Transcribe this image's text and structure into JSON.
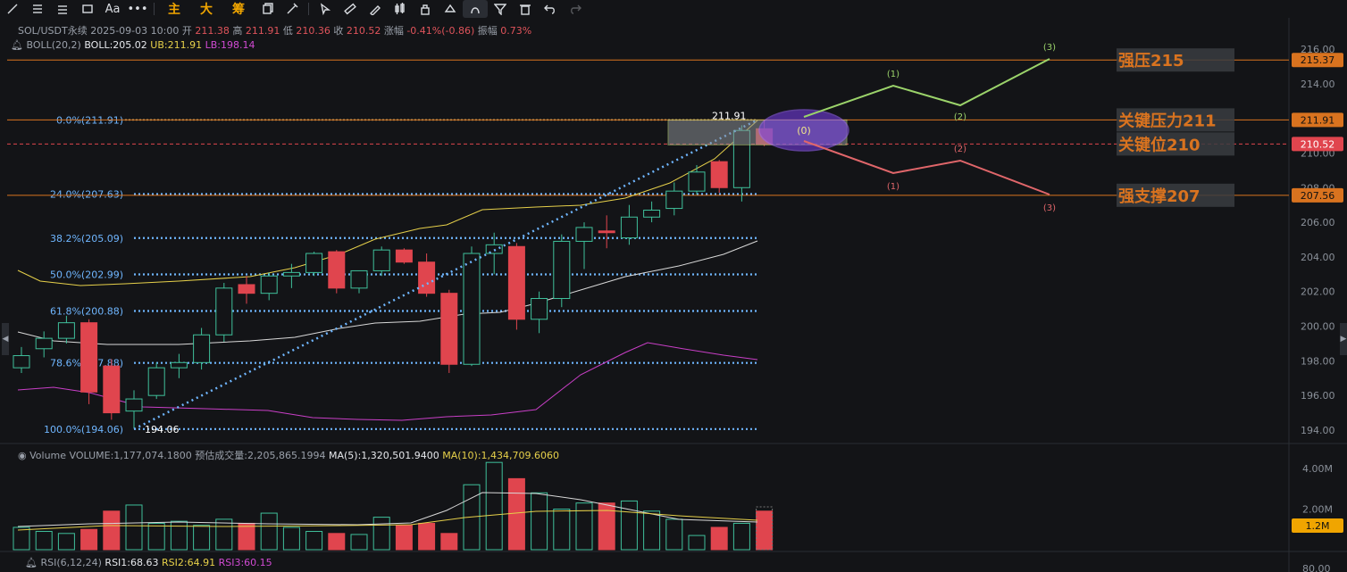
{
  "toolbar": {
    "tools": [
      "line",
      "menu",
      "menu2",
      "rect",
      "text",
      "more"
    ],
    "text_label": "Aa",
    "indicator_main": "主",
    "indicator_big": "大",
    "indicator_chip": "筹"
  },
  "info": {
    "symbol": "SOL/USDT永续",
    "datetime": "2025-09-03 10:00",
    "open_label": "开",
    "open": "211.38",
    "high_label": "高",
    "high": "211.91",
    "low_label": "低",
    "low": "210.36",
    "close_label": "收",
    "close": "210.52",
    "change_label": "涨幅",
    "change": "-0.41%(-0.86)",
    "amp_label": "振幅",
    "amp": "0.73%",
    "boll_name": "BOLL(20,2)",
    "boll_mid": "BOLL:205.02",
    "boll_ub": "UB:211.91",
    "boll_lb": "LB:198.14"
  },
  "volume": {
    "title": "Volume",
    "vol": "VOLUME:1,177,074.1800",
    "est": "预估成交量:2,205,865.1994",
    "ma5": "MA(5):1,320,501.9400",
    "ma10": "MA(10):1,434,709.6060",
    "current_tag": "1.2M",
    "axis": [
      "4.00M",
      "2.00M"
    ]
  },
  "rsi": {
    "name": "RSI(6,12,24)",
    "rsi1": "RSI1:68.63",
    "rsi2": "RSI2:64.91",
    "rsi3": "RSI3:60.15",
    "axis_top": "80.00"
  },
  "price_axis": [
    "216.00",
    "214.00",
    "212.00",
    "210.00",
    "208.00",
    "206.00",
    "204.00",
    "202.00",
    "200.00",
    "198.00",
    "196.00",
    "194.00"
  ],
  "fib": [
    {
      "label": "0.0%(211.91)",
      "price": 211.91
    },
    {
      "label": "24.0%(207.63)",
      "price": 207.63
    },
    {
      "label": "38.2%(205.09)",
      "price": 205.09
    },
    {
      "label": "50.0%(202.99)",
      "price": 202.99
    },
    {
      "label": "61.8%(200.88)",
      "price": 200.88
    },
    {
      "label": "78.6%(197.88)",
      "price": 197.88
    },
    {
      "label": "100.0%(194.06)",
      "price": 194.06
    }
  ],
  "levels": [
    {
      "label": "强压215",
      "price": 215.37,
      "tag": "215.37"
    },
    {
      "label": "关键压力211",
      "price": 211.91,
      "tag": "211.91"
    },
    {
      "label": "关键位210",
      "price": 210.52,
      "tag": "210.52"
    },
    {
      "label": "强支撑207",
      "price": 207.56,
      "tag": "207.56"
    }
  ],
  "annotations": {
    "high_mark": "211.91",
    "low_mark": "194.06",
    "wave0": "(0)",
    "up_waves": [
      "(1)",
      "(2)",
      "(3)"
    ],
    "down_waves": [
      "(1)",
      "(2)",
      "(3)"
    ]
  },
  "colors": {
    "up": "#3fc09b",
    "down": "#e0454e",
    "level": "#d9731f",
    "fib": "#6fb6ff",
    "boll_mid": "#d8d8d8",
    "boll_ub": "#e6d04a",
    "boll_lb": "#c93fc7",
    "wave_up": "#9bd36a",
    "wave_down": "#e0666a"
  },
  "chart_data": {
    "type": "candlestick",
    "candles": [
      {
        "o": 197.6,
        "h": 198.8,
        "l": 197.3,
        "c": 198.3
      },
      {
        "o": 198.7,
        "h": 199.7,
        "l": 198.2,
        "c": 199.3
      },
      {
        "o": 199.3,
        "h": 200.6,
        "l": 199.0,
        "c": 200.2
      },
      {
        "o": 200.2,
        "h": 200.4,
        "l": 195.5,
        "c": 196.2
      },
      {
        "o": 197.7,
        "h": 198.1,
        "l": 194.6,
        "c": 195.0
      },
      {
        "o": 195.1,
        "h": 196.3,
        "l": 194.1,
        "c": 195.8
      },
      {
        "o": 196.0,
        "h": 197.9,
        "l": 195.8,
        "c": 197.6
      },
      {
        "o": 197.6,
        "h": 198.4,
        "l": 197.0,
        "c": 197.9
      },
      {
        "o": 197.9,
        "h": 199.9,
        "l": 197.5,
        "c": 199.5
      },
      {
        "o": 199.5,
        "h": 202.5,
        "l": 199.1,
        "c": 202.2
      },
      {
        "o": 202.4,
        "h": 202.9,
        "l": 201.3,
        "c": 201.9
      },
      {
        "o": 201.9,
        "h": 203.1,
        "l": 201.5,
        "c": 202.9
      },
      {
        "o": 202.9,
        "h": 203.6,
        "l": 202.2,
        "c": 203.1
      },
      {
        "o": 203.1,
        "h": 204.3,
        "l": 202.9,
        "c": 204.2
      },
      {
        "o": 204.3,
        "h": 204.4,
        "l": 201.9,
        "c": 202.2
      },
      {
        "o": 202.2,
        "h": 203.2,
        "l": 201.9,
        "c": 203.2
      },
      {
        "o": 203.2,
        "h": 204.6,
        "l": 202.9,
        "c": 204.4
      },
      {
        "o": 204.4,
        "h": 204.5,
        "l": 203.6,
        "c": 203.7
      },
      {
        "o": 203.7,
        "h": 204.2,
        "l": 201.7,
        "c": 201.9
      },
      {
        "o": 201.9,
        "h": 202.1,
        "l": 197.3,
        "c": 197.8
      },
      {
        "o": 197.8,
        "h": 204.6,
        "l": 197.7,
        "c": 204.2
      },
      {
        "o": 204.2,
        "h": 205.4,
        "l": 203.0,
        "c": 204.7
      },
      {
        "o": 204.6,
        "h": 204.8,
        "l": 199.8,
        "c": 200.4
      },
      {
        "o": 200.4,
        "h": 202.0,
        "l": 199.6,
        "c": 201.6
      },
      {
        "o": 201.6,
        "h": 205.3,
        "l": 201.1,
        "c": 204.9
      },
      {
        "o": 204.9,
        "h": 206.0,
        "l": 203.3,
        "c": 205.7
      },
      {
        "o": 205.5,
        "h": 206.4,
        "l": 204.5,
        "c": 205.4
      },
      {
        "o": 205.1,
        "h": 207.0,
        "l": 204.7,
        "c": 206.3
      },
      {
        "o": 206.3,
        "h": 207.2,
        "l": 206.0,
        "c": 206.7
      },
      {
        "o": 206.8,
        "h": 208.3,
        "l": 206.4,
        "c": 207.8
      },
      {
        "o": 207.8,
        "h": 209.3,
        "l": 207.6,
        "c": 208.9
      },
      {
        "o": 209.5,
        "h": 209.6,
        "l": 207.7,
        "c": 208.0
      },
      {
        "o": 208.0,
        "h": 211.6,
        "l": 207.2,
        "c": 211.3
      },
      {
        "o": 211.4,
        "h": 211.9,
        "l": 210.4,
        "c": 210.5
      }
    ],
    "volume_millions": [
      1.1,
      0.9,
      0.8,
      1.0,
      1.9,
      2.2,
      1.3,
      1.4,
      1.2,
      1.5,
      1.3,
      1.8,
      1.1,
      0.9,
      0.8,
      0.75,
      1.6,
      1.2,
      1.3,
      0.8,
      3.2,
      5.0,
      3.5,
      2.8,
      2.0,
      2.3,
      2.3,
      2.4,
      1.9,
      1.5,
      0.7,
      1.1,
      1.3,
      1.9,
      2.0,
      1.2
    ]
  }
}
